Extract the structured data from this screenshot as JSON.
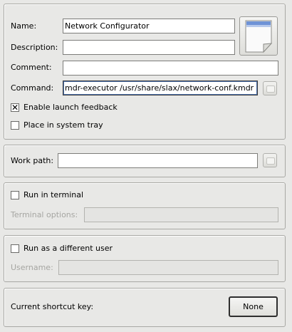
{
  "general": {
    "name_label": "Name:",
    "name_value": "Network Configurator",
    "description_label": "Description:",
    "description_value": "",
    "comment_label": "Comment:",
    "comment_value": "",
    "command_label": "Command:",
    "command_value": "mdr-executor /usr/share/slax/network-conf.kmdr",
    "launch_feedback_label": "Enable launch feedback",
    "launch_feedback_checked": true,
    "system_tray_label": "Place in system tray",
    "system_tray_checked": false,
    "icon_name": "document-icon"
  },
  "work_path": {
    "label": "Work path:",
    "value": ""
  },
  "terminal": {
    "run_label": "Run in terminal",
    "run_checked": false,
    "options_label": "Terminal options:",
    "options_value": ""
  },
  "user": {
    "run_as_label": "Run as a different user",
    "run_as_checked": false,
    "username_label": "Username:",
    "username_value": ""
  },
  "shortcut": {
    "label": "Current shortcut key:",
    "button_label": "None"
  }
}
